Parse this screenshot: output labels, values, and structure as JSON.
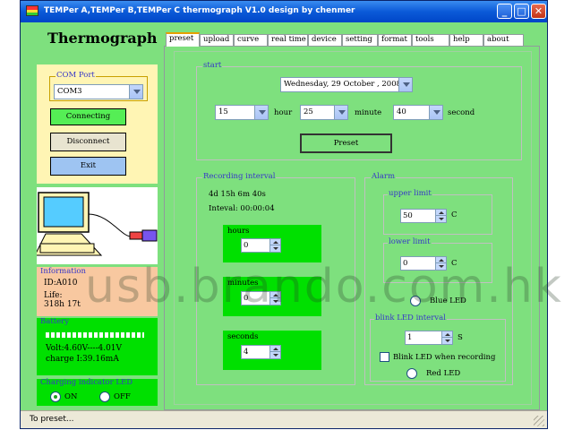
{
  "window": {
    "title": "TEMPer A,TEMPer B,TEMPer C thermograph V1.0 design by chenmer",
    "minimize": "_",
    "maximize": "□",
    "close": "✕"
  },
  "sidebar": {
    "app_name": "Thermograph",
    "com_port": {
      "group_label": "COM Port",
      "selected": "COM3",
      "status": "Connecting",
      "disconnect": "Disconnect",
      "exit": "Exit"
    },
    "information": {
      "group_label": "Information",
      "id": "ID:A010",
      "life_label": "Life:",
      "life_value": "318h  17t"
    },
    "battery": {
      "group_label": "Battery",
      "volt": "Volt:4.60V----4.01V",
      "charge": "charge I:39.16mA",
      "level_fraction": 1.0
    },
    "charging": {
      "group_label": "Charging indicator LED",
      "on": "ON",
      "off": "OFF",
      "selected": "ON"
    }
  },
  "tabs": [
    {
      "label": "preset",
      "active": true
    },
    {
      "label": "upload",
      "active": false
    },
    {
      "label": "curve",
      "active": false
    },
    {
      "label": "real time",
      "active": false
    },
    {
      "label": "device",
      "active": false
    },
    {
      "label": "setting",
      "active": false
    },
    {
      "label": "format",
      "active": false
    },
    {
      "label": "tools",
      "active": false
    },
    {
      "label": "help",
      "active": false
    },
    {
      "label": "about",
      "active": false
    }
  ],
  "preset": {
    "start": {
      "group_label": "start",
      "date": "Wednesday, 29   October , 2008",
      "hour_value": "15",
      "hour_label": "hour",
      "minute_value": "25",
      "minute_label": "minute",
      "second_value": "40",
      "second_label": "second",
      "preset_button": "Preset"
    },
    "recording": {
      "group_label": "Recording interval",
      "duration": "4d 15h 6m 40s",
      "interval": "Inteval: 00:00:04",
      "hours_label": "hours",
      "hours_value": "0",
      "minutes_label": "minutes",
      "minutes_value": "0",
      "seconds_label": "seconds",
      "seconds_value": "4"
    },
    "alarm": {
      "group_label": "Alarm",
      "upper_label": "upper limit",
      "upper_value": "50",
      "upper_unit": "C",
      "lower_label": "lower limit",
      "lower_value": "0",
      "lower_unit": "C",
      "blue_led": "Blue LED",
      "blink_label": "blink LED interval",
      "blink_value": "1",
      "blink_unit": "S",
      "blink_when_recording": "Blink LED when recording",
      "red_led": "Red LED"
    }
  },
  "status_bar": {
    "text": "To preset..."
  },
  "watermark": "usb.brando.com.hk",
  "colors": {
    "panel_green": "#7ee07e",
    "bright_green": "#00e000",
    "info_peach": "#f8c8a0",
    "accent_blue": "#3838c8"
  }
}
